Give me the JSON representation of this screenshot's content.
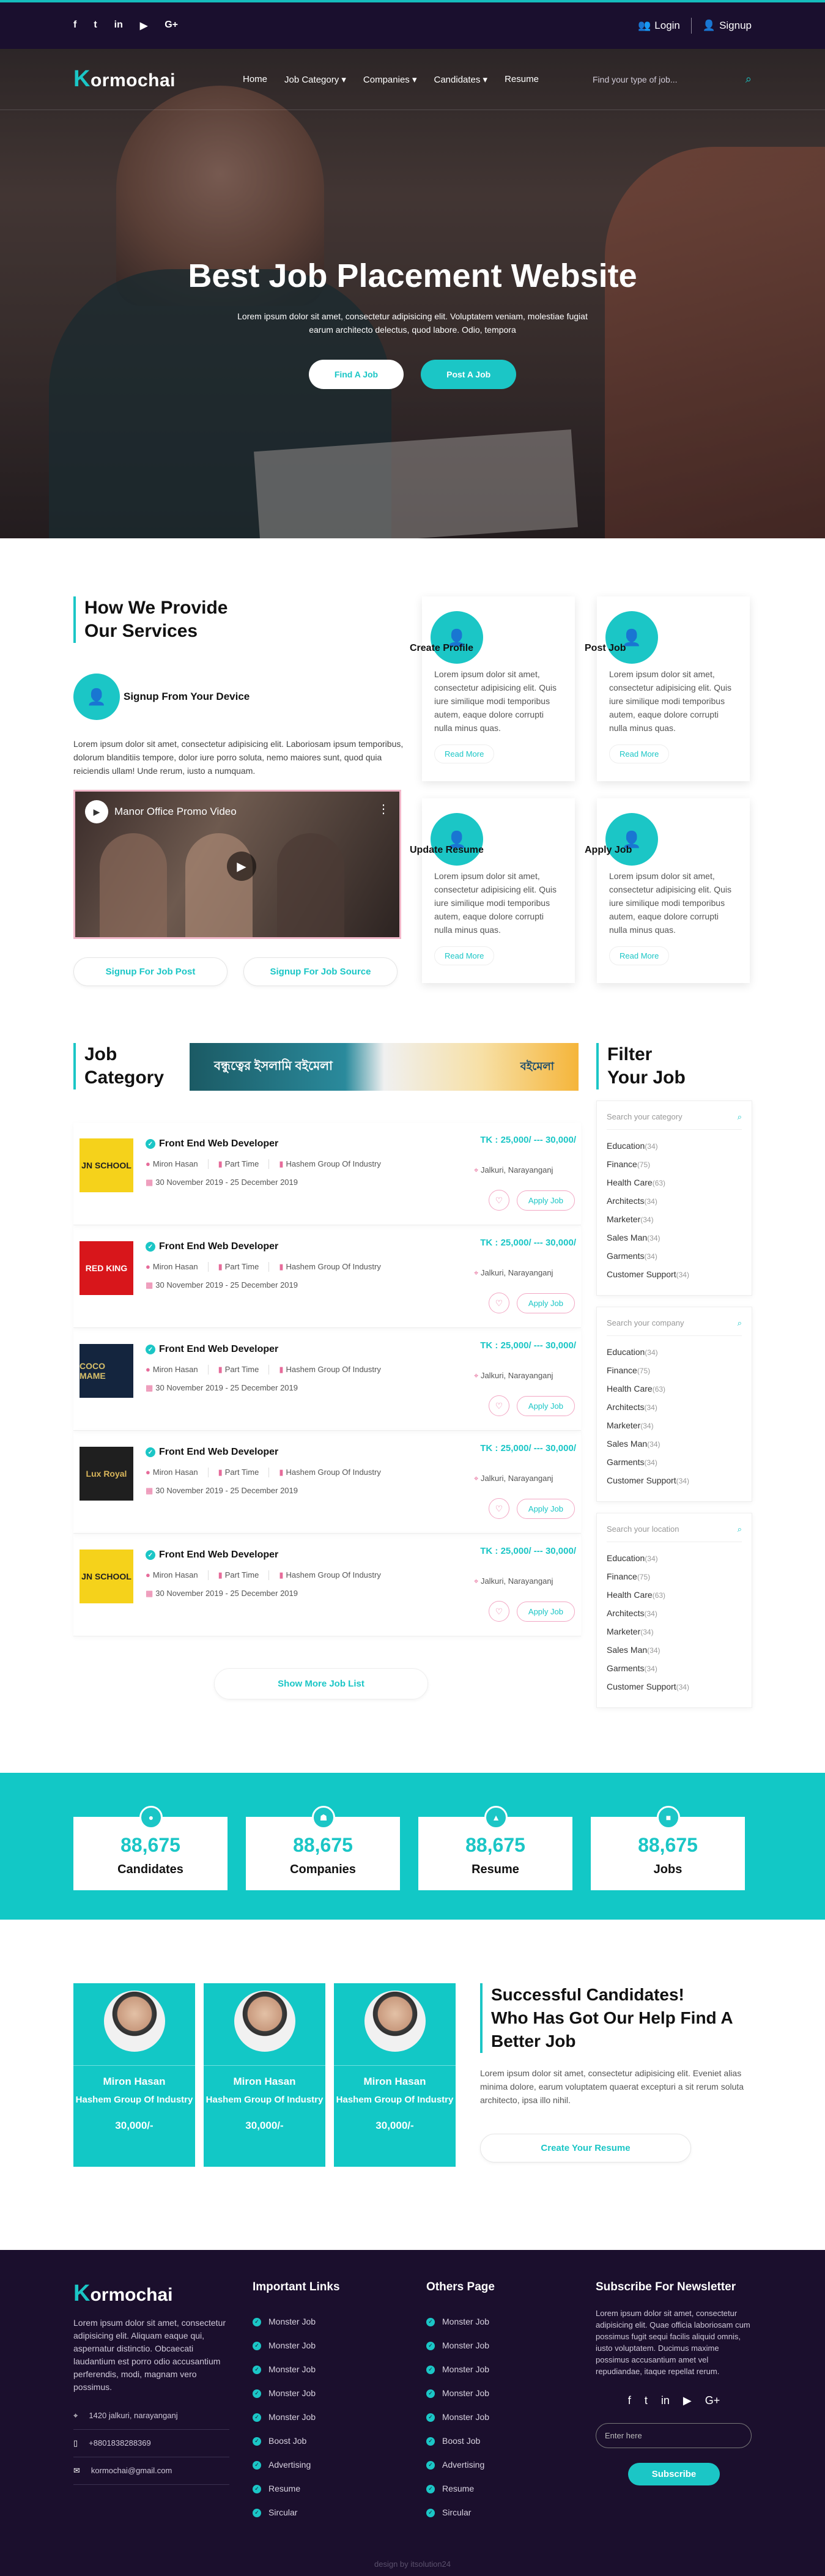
{
  "topbar": {
    "social": [
      "f",
      "t",
      "in",
      "▶",
      "G+"
    ],
    "login": "Login",
    "signup": "Signup"
  },
  "nav": {
    "logo_k": "K",
    "logo_rest": "ormochai",
    "menu": [
      "Home",
      "Job Category ▾",
      "Companies ▾",
      "Candidates ▾",
      "Resume"
    ],
    "search_placeholder": "Find your type of job..."
  },
  "hero": {
    "title": "Best Job Placement Website",
    "subtitle": "Lorem ipsum dolor sit amet, consectetur adipisicing elit. Voluptatem veniam, molestiae fugiat earum architecto delectus, quod labore. Odio, tempora",
    "btn_find": "Find A Job",
    "btn_post": "Post A Job"
  },
  "services": {
    "heading_1": "How We Provide",
    "heading_2": "Our Services",
    "signup_title": "Signup From Your Device",
    "desc": "Lorem ipsum dolor sit amet, consectetur adipisicing elit. Laboriosam ipsum temporibus, dolorum blanditiis tempore, dolor iure porro soluta, nemo maiores sunt, quod quia reiciendis ullam! Unde rerum, iusto a numquam.",
    "video_title": "Manor Office Promo Video",
    "btn_signup_post": "Signup For Job Post",
    "btn_signup_source": "Signup For Job Source",
    "cards": [
      {
        "title": "Create Profile",
        "text": "Lorem ipsum dolor sit amet, consectetur adipisicing elit. Quis iure similique modi temporibus autem, eaque dolore corrupti nulla minus quas.",
        "link": "Read More"
      },
      {
        "title": "Post Job",
        "text": "Lorem ipsum dolor sit amet, consectetur adipisicing elit. Quis iure similique modi temporibus autem, eaque dolore corrupti nulla minus quas.",
        "link": "Read More"
      },
      {
        "title": "Update Resume",
        "text": "Lorem ipsum dolor sit amet, consectetur adipisicing elit. Quis iure similique modi temporibus autem, eaque dolore corrupti nulla minus quas.",
        "link": "Read More"
      },
      {
        "title": "Apply Job",
        "text": "Lorem ipsum dolor sit amet, consectetur adipisicing elit. Quis iure similique modi temporibus autem, eaque dolore corrupti nulla minus quas.",
        "link": "Read More"
      }
    ]
  },
  "jobs": {
    "heading_1": "Job",
    "heading_2": "Category",
    "banner_left": "বন্ধুত্বের ইসলামি বইমেলা",
    "banner_right": "বইমেলা",
    "list": [
      {
        "thumb": "JN SCHOOL",
        "thumb_bg": "#f5d21b",
        "thumb_fg": "#222",
        "title": "Front End Web Developer",
        "person": "Miron Hasan",
        "type": "Part Time",
        "company": "Hashem Group Of Industry",
        "location": "Jalkuri, Narayanganj",
        "date": "30 November 2019 - 25 December 2019",
        "salary": "TK : 25,000/ --- 30,000/",
        "apply": "Apply Job"
      },
      {
        "thumb": "RED KING",
        "thumb_bg": "#d8161b",
        "thumb_fg": "#fff",
        "title": "Front End Web Developer",
        "person": "Miron Hasan",
        "type": "Part Time",
        "company": "Hashem Group Of Industry",
        "location": "Jalkuri, Narayanganj",
        "date": "30 November 2019 - 25 December 2019",
        "salary": "TK : 25,000/ --- 30,000/",
        "apply": "Apply Job"
      },
      {
        "thumb": "COCO MAME",
        "thumb_bg": "#14253e",
        "thumb_fg": "#d8c06a",
        "title": "Front End Web Developer",
        "person": "Miron Hasan",
        "type": "Part Time",
        "company": "Hashem Group Of Industry",
        "location": "Jalkuri, Narayanganj",
        "date": "30 November 2019 - 25 December 2019",
        "salary": "TK : 25,000/ --- 30,000/",
        "apply": "Apply Job"
      },
      {
        "thumb": "Lux Royal",
        "thumb_bg": "#1f1f1f",
        "thumb_fg": "#d8b55a",
        "title": "Front End Web Developer",
        "person": "Miron Hasan",
        "type": "Part Time",
        "company": "Hashem Group Of Industry",
        "location": "Jalkuri, Narayanganj",
        "date": "30 November 2019 - 25 December 2019",
        "salary": "TK : 25,000/ --- 30,000/",
        "apply": "Apply Job"
      },
      {
        "thumb": "JN SCHOOL",
        "thumb_bg": "#f5d21b",
        "thumb_fg": "#222",
        "title": "Front End Web Developer",
        "person": "Miron Hasan",
        "type": "Part Time",
        "company": "Hashem Group Of Industry",
        "location": "Jalkuri, Narayanganj",
        "date": "30 November 2019 - 25 December 2019",
        "salary": "TK : 25,000/ --- 30,000/",
        "apply": "Apply Job"
      }
    ],
    "show_more": "Show More Job List"
  },
  "filter": {
    "heading_1": "Filter",
    "heading_2": "Your Job",
    "boxes": [
      {
        "placeholder": "Search your category",
        "items": [
          [
            "Education",
            "(34)"
          ],
          [
            "Finance",
            "(75)"
          ],
          [
            "Health Care",
            "(63)"
          ],
          [
            "Architects",
            "(34)"
          ],
          [
            "Marketer",
            "(34)"
          ],
          [
            "Sales Man",
            "(34)"
          ],
          [
            "Garments",
            "(34)"
          ],
          [
            "Customer Support",
            "(34)"
          ]
        ]
      },
      {
        "placeholder": "Search your company",
        "items": [
          [
            "Education",
            "(34)"
          ],
          [
            "Finance",
            "(75)"
          ],
          [
            "Health Care",
            "(63)"
          ],
          [
            "Architects",
            "(34)"
          ],
          [
            "Marketer",
            "(34)"
          ],
          [
            "Sales Man",
            "(34)"
          ],
          [
            "Garments",
            "(34)"
          ],
          [
            "Customer Support",
            "(34)"
          ]
        ]
      },
      {
        "placeholder": "Search your location",
        "items": [
          [
            "Education",
            "(34)"
          ],
          [
            "Finance",
            "(75)"
          ],
          [
            "Health Care",
            "(63)"
          ],
          [
            "Architects",
            "(34)"
          ],
          [
            "Marketer",
            "(34)"
          ],
          [
            "Sales Man",
            "(34)"
          ],
          [
            "Garments",
            "(34)"
          ],
          [
            "Customer Support",
            "(34)"
          ]
        ]
      }
    ]
  },
  "counts": [
    {
      "num": "88,675",
      "label": "Candidates",
      "icon": "user-icon"
    },
    {
      "num": "88,675",
      "label": "Companies",
      "icon": "team-icon"
    },
    {
      "num": "88,675",
      "label": "Resume",
      "icon": "graduate-icon"
    },
    {
      "num": "88,675",
      "label": "Jobs",
      "icon": "gift-icon"
    }
  ],
  "success": {
    "heading_1": "Successful Candidates!",
    "heading_2": "Who Has Got Our Help Find A",
    "heading_3": "Better Job",
    "text": "Lorem ipsum dolor sit amet, consectetur adipisicing elit. Eveniet alias minima dolore, earum voluptatem quaerat excepturi a sit rerum soluta architecto, ipsa illo nihil.",
    "btn": "Create Your Resume",
    "candidates": [
      {
        "name": "Miron Hasan",
        "company": "Hashem Group Of Industry",
        "salary": "30,000/-"
      },
      {
        "name": "Miron Hasan",
        "company": "Hashem Group Of Industry",
        "salary": "30,000/-"
      },
      {
        "name": "Miron Hasan",
        "company": "Hashem Group Of Industry",
        "salary": "30,000/-"
      }
    ]
  },
  "footer": {
    "logo_k": "K",
    "logo_rest": "ormochai",
    "about": "Lorem ipsum dolor sit amet, consectetur adipisicing elit. Aliquam eaque qui, aspernatur distinctio. Obcaecati laudantium est porro odio accusantium perferendis, modi, magnam vero possimus.",
    "address": "1420 jalkuri, narayanganj",
    "phone": "+8801838288369",
    "email": "kormochai@gmail.com",
    "important_title": "Important Links",
    "important": [
      "Monster Job",
      "Monster Job",
      "Monster Job",
      "Monster Job",
      "Monster Job",
      "Boost Job",
      "Advertising",
      "Resume",
      "Sircular"
    ],
    "others_title": "Others Page",
    "others": [
      "Monster Job",
      "Monster Job",
      "Monster Job",
      "Monster Job",
      "Monster Job",
      "Boost Job",
      "Advertising",
      "Resume",
      "Sircular"
    ],
    "newsletter_title": "Subscribe For Newsletter",
    "newsletter_text": "Lorem ipsum dolor sit amet, consectetur adipisicing elit. Quae officia laboriosam cum possimus fugit sequi facilis aliquid omnis, iusto voluptatem. Ducimus maxime possimus accusantium amet vel repudiandae, itaque repellat rerum.",
    "social": [
      "f",
      "t",
      "in",
      "▶",
      "G+"
    ],
    "email_placeholder": "Enter here",
    "subscribe": "Subscribe",
    "copyright": "design by itsolution24"
  }
}
